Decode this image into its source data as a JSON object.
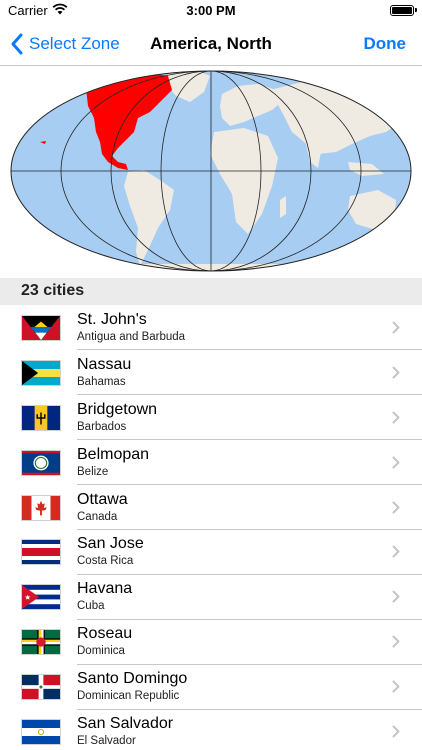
{
  "status_bar": {
    "carrier": "Carrier",
    "time": "3:00 PM"
  },
  "nav": {
    "back_label": "Select Zone",
    "title": "America, North",
    "done_label": "Done"
  },
  "map": {
    "highlight_region": "North America",
    "highlight_color": "#ff0000",
    "ocean_color": "#a7cdf2",
    "land_color": "#efebe2"
  },
  "list": {
    "header": "23 cities",
    "cities": [
      {
        "name": "St. John's",
        "country": "Antigua and Barbuda",
        "flag": "antigua-and-barbuda"
      },
      {
        "name": "Nassau",
        "country": "Bahamas",
        "flag": "bahamas"
      },
      {
        "name": "Bridgetown",
        "country": "Barbados",
        "flag": "barbados"
      },
      {
        "name": "Belmopan",
        "country": "Belize",
        "flag": "belize"
      },
      {
        "name": "Ottawa",
        "country": "Canada",
        "flag": "canada"
      },
      {
        "name": "San Jose",
        "country": "Costa Rica",
        "flag": "costa-rica"
      },
      {
        "name": "Havana",
        "country": "Cuba",
        "flag": "cuba"
      },
      {
        "name": "Roseau",
        "country": "Dominica",
        "flag": "dominica"
      },
      {
        "name": "Santo Domingo",
        "country": "Dominican Republic",
        "flag": "dominican-republic"
      },
      {
        "name": "San Salvador",
        "country": "El Salvador",
        "flag": "el-salvador"
      }
    ]
  }
}
